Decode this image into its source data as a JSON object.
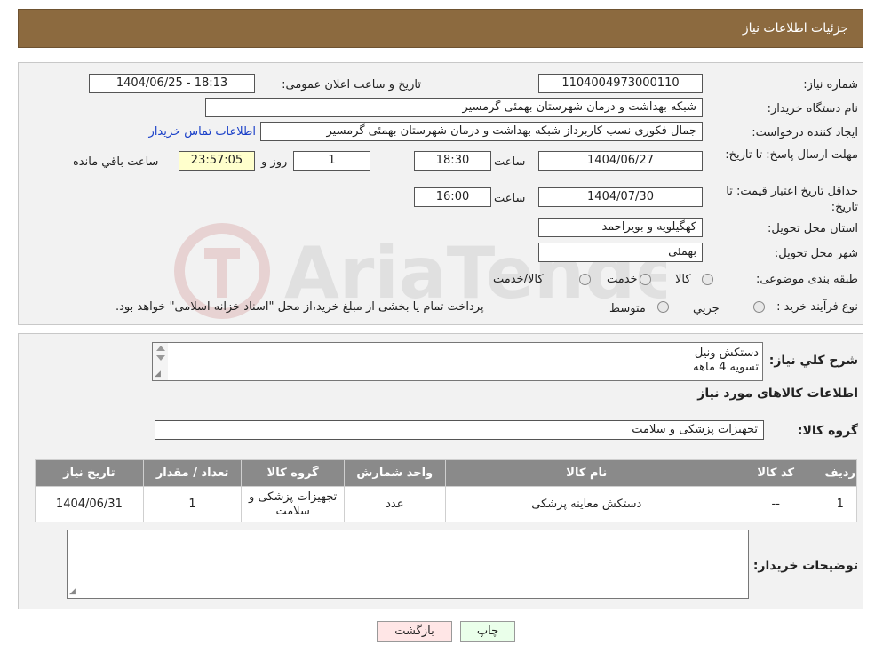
{
  "header": {
    "title": "جزئیات اطلاعات نیاز"
  },
  "info": {
    "need_number_label": "شماره نیاز:",
    "need_number": "1104004973000110",
    "announce_label": "تاریخ و ساعت اعلان عمومی:",
    "announce_value": "1404/06/25 - 18:13",
    "buyer_org_label": "نام دستگاه خریدار:",
    "buyer_org": "شبکه بهداشت و درمان شهرستان بهمئی گرمسیر",
    "requester_label": "ایجاد کننده درخواست:",
    "requester": "جمال  فکوری نسب کاربرداز شبکه بهداشت و درمان شهرستان بهمئی گرمسیر",
    "contact_link": "اطلاعات تماس خریدار",
    "deadline_label": "مهلت ارسال پاسخ: تا تاریخ:",
    "deadline_date": "1404/06/27",
    "time_label": "ساعت",
    "deadline_time": "18:30",
    "days_value": "1",
    "days_label": "روز و",
    "remaining_time": "23:57:05",
    "remaining_label": "ساعت باقي مانده",
    "validity_label": "حداقل تاریخ اعتبار قیمت: تا تاریخ:",
    "validity_date": "1404/07/30",
    "validity_time": "16:00",
    "province_label": "استان محل تحویل:",
    "province": "کهگیلویه و بویراحمد",
    "city_label": "شهر محل تحویل:",
    "city": "بهمئی",
    "category_label": "طبقه بندی موضوعی:",
    "category_options": [
      "کالا",
      "خدمت",
      "کالا/خدمت"
    ],
    "process_label": "نوع فرآیند خرید :",
    "process_options": [
      "جزیي",
      "متوسط"
    ],
    "process_note": "پرداخت تمام یا بخشی از مبلغ خرید،از محل \"اسناد خزانه اسلامی\" خواهد بود."
  },
  "description": {
    "label": "شرح کلي نياز:",
    "line1": "دستکش ونیل",
    "line2": "تسویه 4 ماهه"
  },
  "goods": {
    "section_title": "اطلاعات کالاهای مورد نیاز",
    "group_label": "گروه کالا:",
    "group_value": "تجهیزات پزشکی و سلامت",
    "columns": [
      "ردیف",
      "کد کالا",
      "نام کالا",
      "واحد شمارش",
      "گروه کالا",
      "تعداد / مقدار",
      "تاریخ نیاز"
    ],
    "rows": [
      [
        "1",
        "--",
        "دستکش معاینه پزشکی",
        "عدد",
        "تجهیزات پزشکی و سلامت",
        "1",
        "1404/06/31"
      ]
    ]
  },
  "buyer_notes": {
    "label": "توضیحات خریدار:",
    "value": ""
  },
  "buttons": {
    "print": "چاپ",
    "back": "بازگشت"
  },
  "watermark_text": "AriaTender.neT",
  "colors": {
    "header": "#8c6a3f",
    "panel": "#f2f2f2",
    "table_header": "#8a8a8a",
    "link": "#1a40c8",
    "print_btn": "#eaffea",
    "back_btn": "#ffe6e6",
    "remaining_bg": "#ffffcc"
  }
}
